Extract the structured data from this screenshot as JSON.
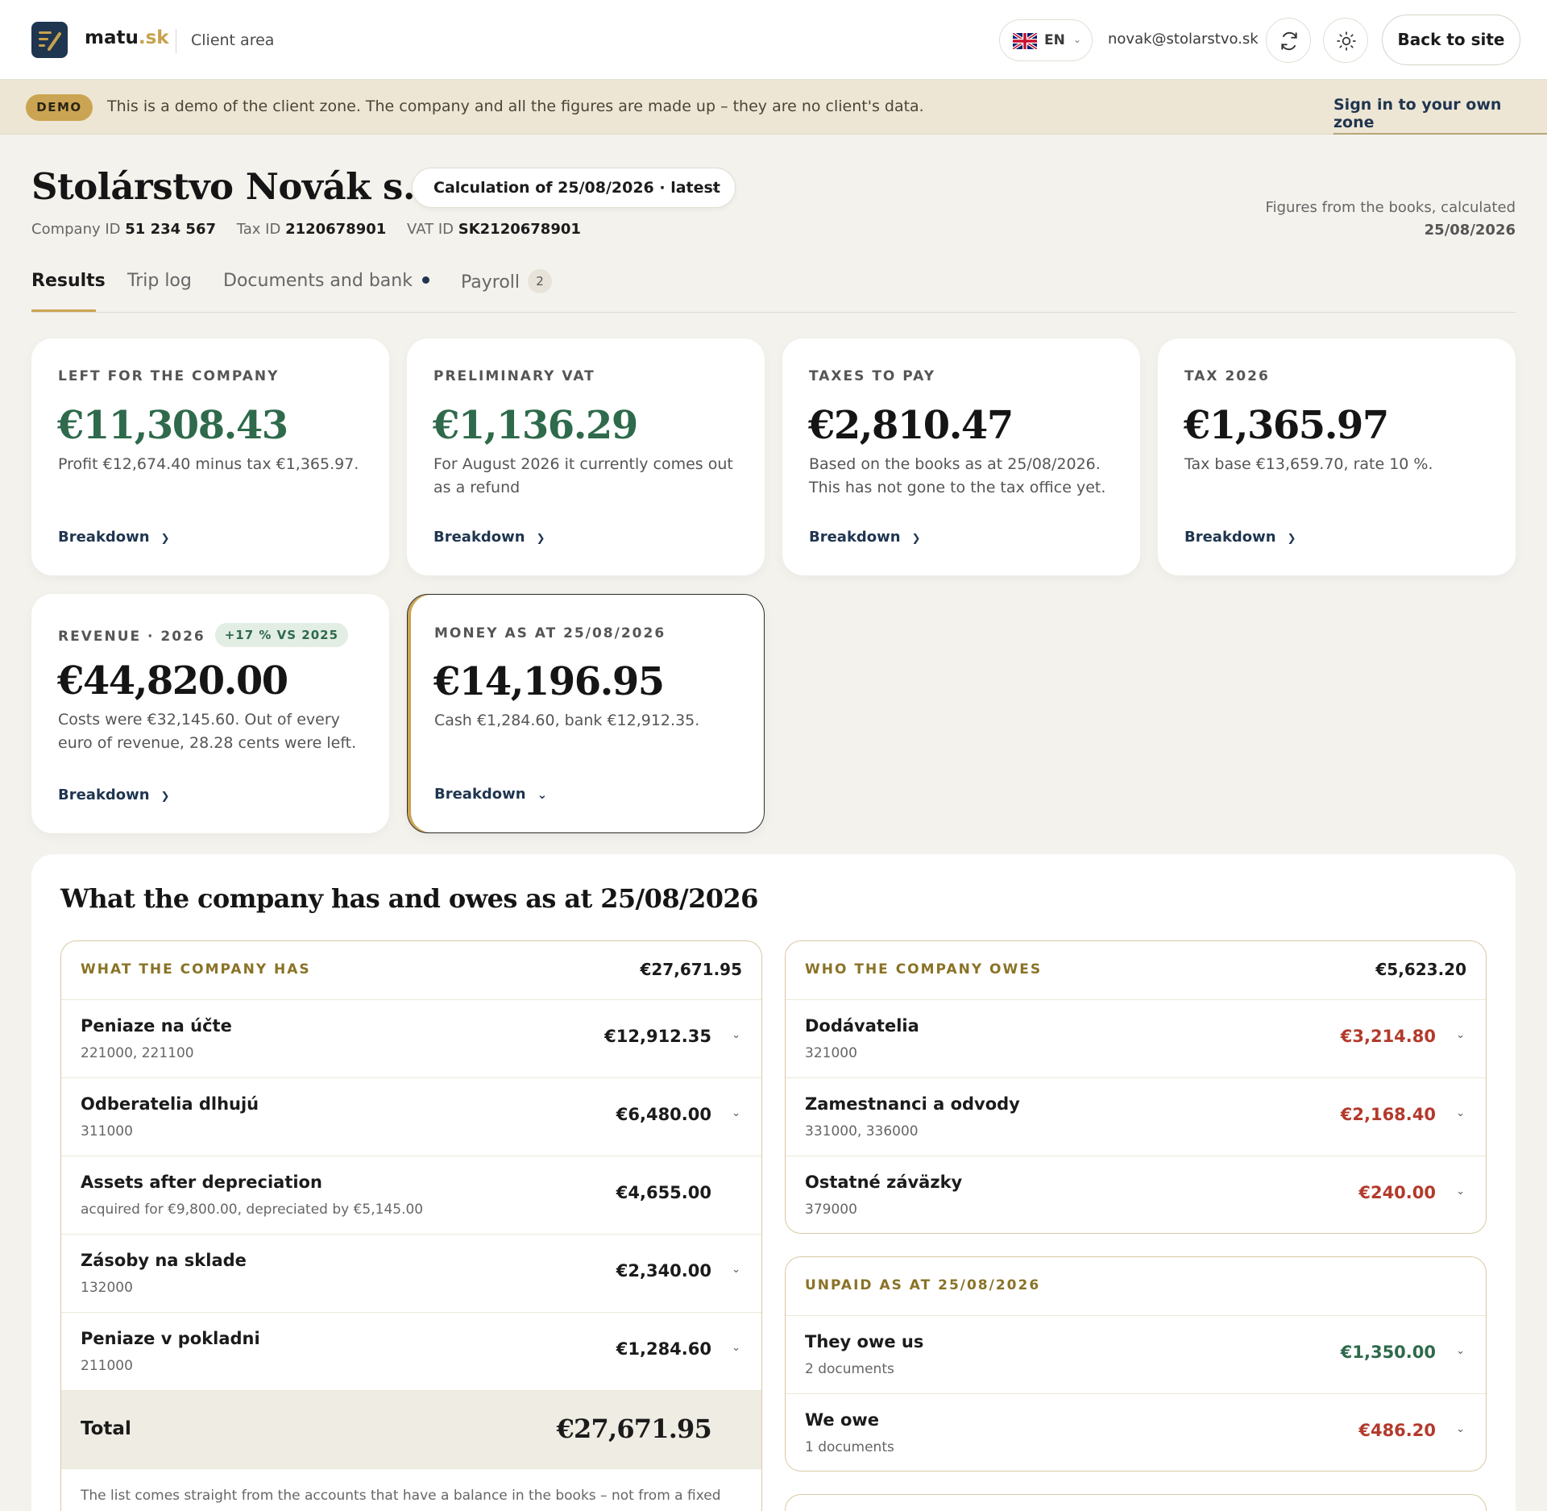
{
  "header": {
    "brand_name": "matu",
    "brand_tld": ".sk",
    "area_label": "Client area",
    "language": "EN",
    "user_email": "novak@stolarstvo.sk",
    "back_button": "Back to site"
  },
  "banner": {
    "badge": "DEMO",
    "text": "This is a demo of the client zone. The company and all the figures are made up – they are no client's data.",
    "link": "Sign in to your own zone"
  },
  "company": {
    "name": "Stolárstvo Novák s. r. o.",
    "calculation_select": "Calculation of 25/08/2026 · latest",
    "company_id_label": "Company ID",
    "company_id": "51 234 567",
    "tax_id_label": "Tax ID",
    "tax_id": "2120678901",
    "vat_id_label": "VAT ID",
    "vat_id": "SK2120678901",
    "figures_note": "Figures from the books, calculated",
    "figures_date": "25/08/2026"
  },
  "tabs": [
    {
      "label": "Results",
      "active": true
    },
    {
      "label": "Trip log"
    },
    {
      "label": "Documents and bank"
    },
    {
      "label": "Payroll",
      "count": "2"
    }
  ],
  "cards": [
    {
      "label": "LEFT FOR THE COMPANY",
      "value": "€11,308.43",
      "desc": "Profit €12,674.40 minus tax €1,365.97.",
      "link": "Breakdown"
    },
    {
      "label": "PRELIMINARY VAT",
      "value": "€1,136.29",
      "desc": "For August 2026 it currently comes out as a refund",
      "link": "Breakdown"
    },
    {
      "label": "TAXES TO PAY",
      "value": "€2,810.47",
      "desc": "Based on the books as at 25/08/2026. This has not gone to the tax office yet.",
      "link": "Breakdown"
    },
    {
      "label": "TAX 2026",
      "value": "€1,365.97",
      "desc": "Tax base €13,659.70, rate 10 %.",
      "link": "Breakdown"
    },
    {
      "label": "REVENUE · 2026",
      "badge": "+17 % VS 2025",
      "value": "€44,820.00",
      "desc": "Costs were €32,145.60. Out of every euro of revenue, 28.28 cents were left.",
      "link": "Breakdown"
    },
    {
      "label": "MONEY AS AT 25/08/2026",
      "value": "€14,196.95",
      "desc": "Cash €1,284.60, bank €12,912.35.",
      "link": "Breakdown"
    }
  ],
  "balance": {
    "title": "What the company has and owes as at 25/08/2026",
    "has": {
      "heading": "WHAT THE COMPANY HAS",
      "total_value": "€27,671.95",
      "rows": [
        {
          "name": "Peniaze na účte",
          "sub": "221000, 221100",
          "amount": "€12,912.35"
        },
        {
          "name": "Odberatelia dlhujú",
          "sub": "311000",
          "amount": "€6,480.00"
        },
        {
          "name": "Assets after depreciation",
          "sub": "acquired for €9,800.00, depreciated by €5,145.00",
          "amount": "€4,655.00"
        },
        {
          "name": "Zásoby na sklade",
          "sub": "132000",
          "amount": "€2,340.00"
        },
        {
          "name": "Peniaze v pokladni",
          "sub": "211000",
          "amount": "€1,284.60"
        }
      ],
      "total_label": "Total",
      "total_amount": "€27,671.95",
      "note": "The list comes straight from the accounts that have a balance in the books – not from a fixed"
    },
    "owes": {
      "heading": "WHO THE COMPANY OWES",
      "total_value": "€5,623.20",
      "rows": [
        {
          "name": "Dodávatelia",
          "sub": "321000",
          "amount": "€3,214.80"
        },
        {
          "name": "Zamestnanci a odvody",
          "sub": "331000, 336000",
          "amount": "€2,168.40"
        },
        {
          "name": "Ostatné záväzky",
          "sub": "379000",
          "amount": "€240.00"
        }
      ]
    },
    "unpaid": {
      "heading": "UNPAID AS AT 25/08/2026",
      "rows": [
        {
          "name": "They owe us",
          "sub": "2 documents",
          "amount": "€1,350.00"
        },
        {
          "name": "We owe",
          "sub": "1 documents",
          "amount": "€486.20"
        }
      ]
    }
  },
  "colors": {
    "accent_gold": "#cba453",
    "navy": "#1f3550",
    "positive_green": "#2e6a4b",
    "negative_red": "#b33a2c"
  }
}
